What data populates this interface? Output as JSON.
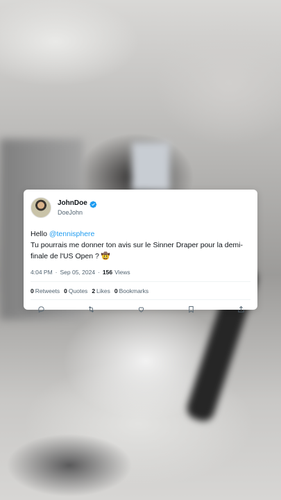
{
  "tweet": {
    "display_name": "JohnDoe",
    "handle": "DoeJohn",
    "text_greeting": "Hello ",
    "mention": "@tennisphere",
    "text_body": "Tu pourrais me donner ton avis sur le Sinner Draper pour la demi-finale de l'US Open ? 🤠",
    "time": "4:04 PM",
    "separator": "·",
    "date": "Sep 05, 2024",
    "views_count": "156",
    "views_label": "Views",
    "stats": {
      "retweets_count": "0",
      "retweets_label": "Retweets",
      "quotes_count": "0",
      "quotes_label": "Quotes",
      "likes_count": "2",
      "likes_label": "Likes",
      "bookmarks_count": "0",
      "bookmarks_label": "Bookmarks"
    },
    "accent_color": "#1d9bf0",
    "actions": [
      "reply-icon",
      "retweet-icon",
      "like-icon",
      "bookmark-icon",
      "share-icon"
    ]
  }
}
